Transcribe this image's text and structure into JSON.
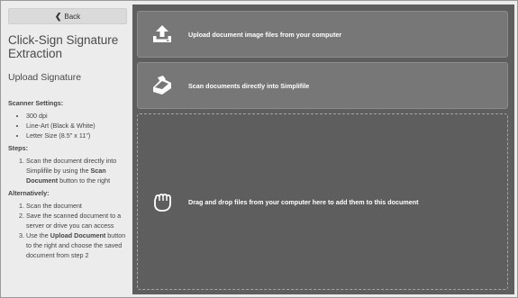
{
  "sidebar": {
    "back_label": "Back",
    "title": "Click-Sign Signature Extraction",
    "subtitle": "Upload Signature",
    "scanner_settings_heading": "Scanner Settings:",
    "scanner_settings": [
      "300 dpi",
      "Line-Art (Black & White)",
      "Letter Size (8.5\" x 11\")"
    ],
    "steps_heading": "Steps:",
    "step1": {
      "pre": "Scan the document directly into Simplifile by using the ",
      "bold": "Scan Document",
      "post": " button to the right"
    },
    "alternatively_heading": "Alternatively:",
    "alt1": "Scan the document",
    "alt2": "Save the scanned document to a server or drive you can access",
    "alt3": {
      "pre": "Use the ",
      "bold": "Upload Document",
      "post": " button to the right and choose the saved document from step 2"
    }
  },
  "main": {
    "upload_label": "Upload document image files from your computer",
    "scan_label": "Scan documents directly into Simplifile",
    "drop_label": "Drag and drop files from your computer here to add them to this document"
  },
  "icons": {
    "back": "chevron-left-icon",
    "upload": "upload-icon",
    "scan": "scanner-icon",
    "drop": "hand-grab-icon"
  },
  "colors": {
    "panel_bg": "#5e5e5e",
    "button_bg": "#777777",
    "sidebar_bg": "#ececec"
  }
}
